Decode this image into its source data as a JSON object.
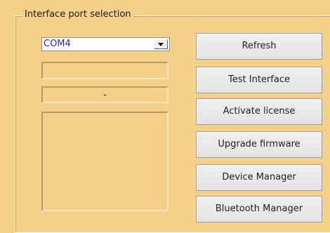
{
  "group": {
    "title": "Interface port selection"
  },
  "port_select": {
    "value": "COM4"
  },
  "status": {
    "field_1": "",
    "field_2": "-"
  },
  "device_list": {
    "items": []
  },
  "buttons": {
    "refresh": "Refresh",
    "test_interface": "Test Interface",
    "activate_license": "Activate license",
    "upgrade_firmware": "Upgrade firmware",
    "device_manager": "Device Manager",
    "bluetooth_manager": "Bluetooth Manager"
  },
  "colors": {
    "background": "#f5d089",
    "button_face": "#e6e6e6",
    "port_text": "#2c2b8f",
    "text": "#1f1f1f"
  },
  "icons": {
    "dropdown": "chevron-down-icon"
  }
}
